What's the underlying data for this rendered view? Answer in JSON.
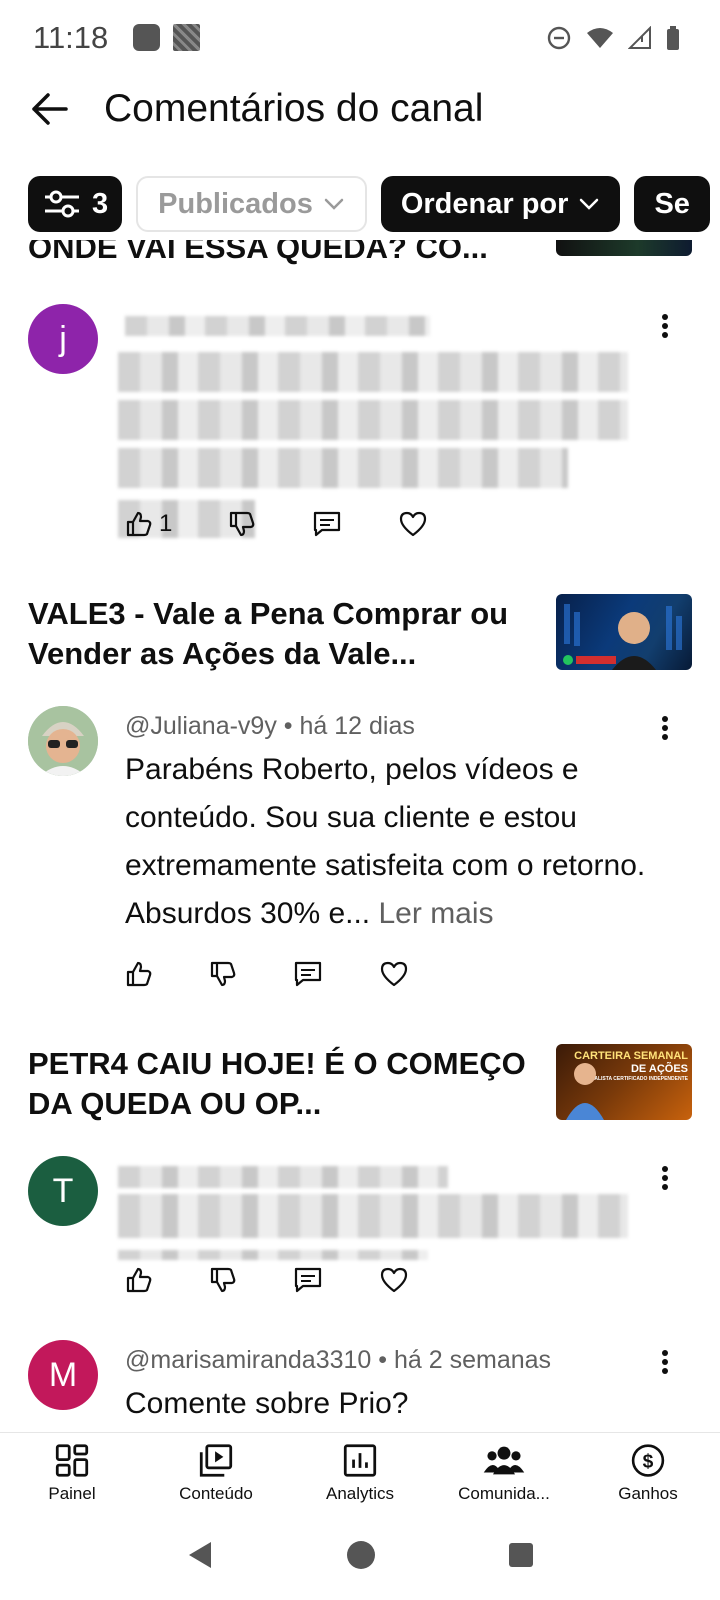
{
  "status_bar": {
    "time": "11:18"
  },
  "header": {
    "title": "Comentários do canal"
  },
  "filters": {
    "filter_count": "3",
    "published": "Publicados",
    "sort": "Ordenar por",
    "next_partial": "Se"
  },
  "videos": [
    {
      "title": "ONDE VAI ESSA QUEDA? CO..."
    },
    {
      "title": "VALE3 - Vale a Pena Comprar ou Vender as Ações da Vale..."
    },
    {
      "title": "PETR4 CAIU HOJE! É O COMEÇO DA QUEDA OU OP..."
    }
  ],
  "comments": [
    {
      "avatar_letter": "j",
      "avatar_color": "#8e24aa",
      "like_count": "1"
    },
    {
      "author": "@Juliana-v9y",
      "age": "há 12 dias",
      "text": "Parabéns Roberto, pelos vídeos e conteúdo. Sou sua cliente e estou extremamente satisfeita com o retorno. Absurdos 30% e...",
      "more": "Ler mais"
    },
    {
      "avatar_letter": "T",
      "avatar_color": "#1b5e40"
    },
    {
      "avatar_letter": "M",
      "avatar_color": "#c2185b",
      "author": "@marisamiranda3310",
      "age": "há 2 semanas",
      "text": "Comente sobre Prio?"
    }
  ],
  "thumbs": {
    "vale_caption": "",
    "petr_line1": "CARTEIRA SEMANAL",
    "petr_line2": "DE AÇÕES",
    "petr_line3": "ANALISTA CERTIFICADO INDEPENDENTE"
  },
  "bottom_nav": [
    {
      "label": "Painel"
    },
    {
      "label": "Conteúdo"
    },
    {
      "label": "Analytics"
    },
    {
      "label": "Comunida..."
    },
    {
      "label": "Ganhos"
    }
  ]
}
